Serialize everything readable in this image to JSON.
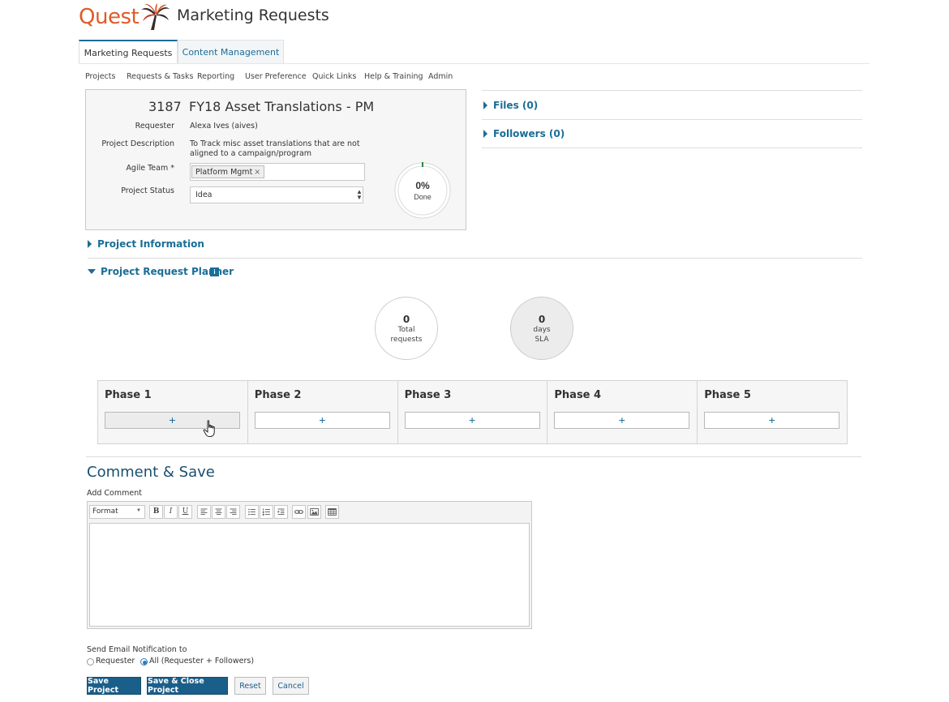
{
  "header": {
    "logo_text": "Quest",
    "app_title": "Marketing Requests"
  },
  "tabs": [
    {
      "label": "Marketing Requests",
      "active": true
    },
    {
      "label": "Content Management",
      "active": false
    }
  ],
  "subnav": [
    "Projects",
    "Requests & Tasks",
    "Reporting",
    "User Preference",
    "Quick Links",
    "Help & Training",
    "Admin"
  ],
  "project": {
    "id": "3187",
    "name": "FY18 Asset Translations - PM",
    "requester_label": "Requester",
    "requester": "Alexa Ives (aives)",
    "description_label": "Project Description",
    "description_line1": "To Track misc asset translations that are not",
    "description_line2": "aligned to a campaign/program",
    "agile_team_label": "Agile Team *",
    "agile_team_tag": "Platform Mgmt",
    "tag_remove": "×",
    "status_label": "Project Status",
    "status_value": "Idea",
    "select_arrow": "▲\n▼",
    "progress_pct": "0%",
    "progress_value": 0,
    "progress_label": "Done"
  },
  "right_panel": {
    "files": "Files (0)",
    "followers": "Followers (0)"
  },
  "sections": {
    "project_information": "Project Information",
    "request_planner": "Project Request Planner",
    "info_icon": "i"
  },
  "stats": {
    "total_value": "0",
    "total_label_line1": "Total",
    "total_label_line2": "requests",
    "sla_value": "0",
    "sla_label_line1": "days",
    "sla_label_line2": "SLA"
  },
  "phases": [
    {
      "title": "Phase 1",
      "add": "+"
    },
    {
      "title": "Phase 2",
      "add": "+"
    },
    {
      "title": "Phase 3",
      "add": "+"
    },
    {
      "title": "Phase 4",
      "add": "+"
    },
    {
      "title": "Phase 5",
      "add": "+"
    }
  ],
  "comment": {
    "title": "Comment & Save",
    "add_label": "Add Comment",
    "format_label": "Format",
    "format_arrow": "▼",
    "toolbar": {
      "bold": "B",
      "italic": "I",
      "underline": "U"
    }
  },
  "notification": {
    "label": "Send Email Notification to",
    "option_requester": "Requester",
    "option_all": "All (Requester + Followers)",
    "selected": "all"
  },
  "buttons": {
    "save": "Save Project",
    "save_close": "Save & Close Project",
    "reset": "Reset",
    "cancel": "Cancel"
  },
  "colors": {
    "brand_orange": "#e05a28",
    "link_blue": "#1a6d96",
    "primary_button": "#1a5f8a",
    "progress_ring": "#2e8b3a"
  }
}
